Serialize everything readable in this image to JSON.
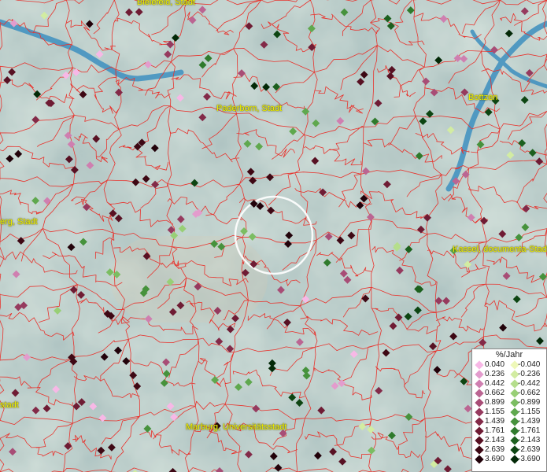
{
  "map": {
    "cities": [
      {
        "name": "Bielefeld, Stadt"
      },
      {
        "name": "Paderborn, Stadt"
      },
      {
        "name": "erg, Stadt"
      },
      {
        "name": "Bottzen"
      },
      {
        "name": "Kassel, documenta-Stadt"
      },
      {
        "name": "stadt"
      },
      {
        "name": "Marburg, Universitätsstadt"
      }
    ],
    "colors": {
      "background": "#8fb3b0",
      "borders": "#e8322c",
      "water": "#3d8fbf",
      "selection_ring": "#ffffff"
    }
  },
  "legend": {
    "title": "%/Jahr",
    "positive": [
      {
        "label": "0.040",
        "color": "#f7b8e6"
      },
      {
        "label": "0.236",
        "color": "#e39ccd"
      },
      {
        "label": "0.442",
        "color": "#cf7fb0"
      },
      {
        "label": "0.662",
        "color": "#bb6592"
      },
      {
        "label": "0.899",
        "color": "#a84d76"
      },
      {
        "label": "1.155",
        "color": "#963a5e"
      },
      {
        "label": "1.439",
        "color": "#832a48"
      },
      {
        "label": "1.761",
        "color": "#6f1c34"
      },
      {
        "label": "2.143",
        "color": "#581123"
      },
      {
        "label": "2.639",
        "color": "#3e0814"
      },
      {
        "label": "3.690",
        "color": "#22020a"
      }
    ],
    "negative": [
      {
        "label": "-0.040",
        "color": "#eef8b8"
      },
      {
        "label": "-0.236",
        "color": "#d2eca2"
      },
      {
        "label": "-0.442",
        "color": "#b5de8c"
      },
      {
        "label": "-0.662",
        "color": "#98cf76"
      },
      {
        "label": "-0.899",
        "color": "#7bbd62"
      },
      {
        "label": "-1.155",
        "color": "#5fa84e"
      },
      {
        "label": "-1.439",
        "color": "#46923c"
      },
      {
        "label": "-1.761",
        "color": "#2f7a2c"
      },
      {
        "label": "-2.143",
        "color": "#1c601e"
      },
      {
        "label": "-2.639",
        "color": "#0d4512"
      },
      {
        "label": "-3.690",
        "color": "#032907"
      }
    ]
  }
}
